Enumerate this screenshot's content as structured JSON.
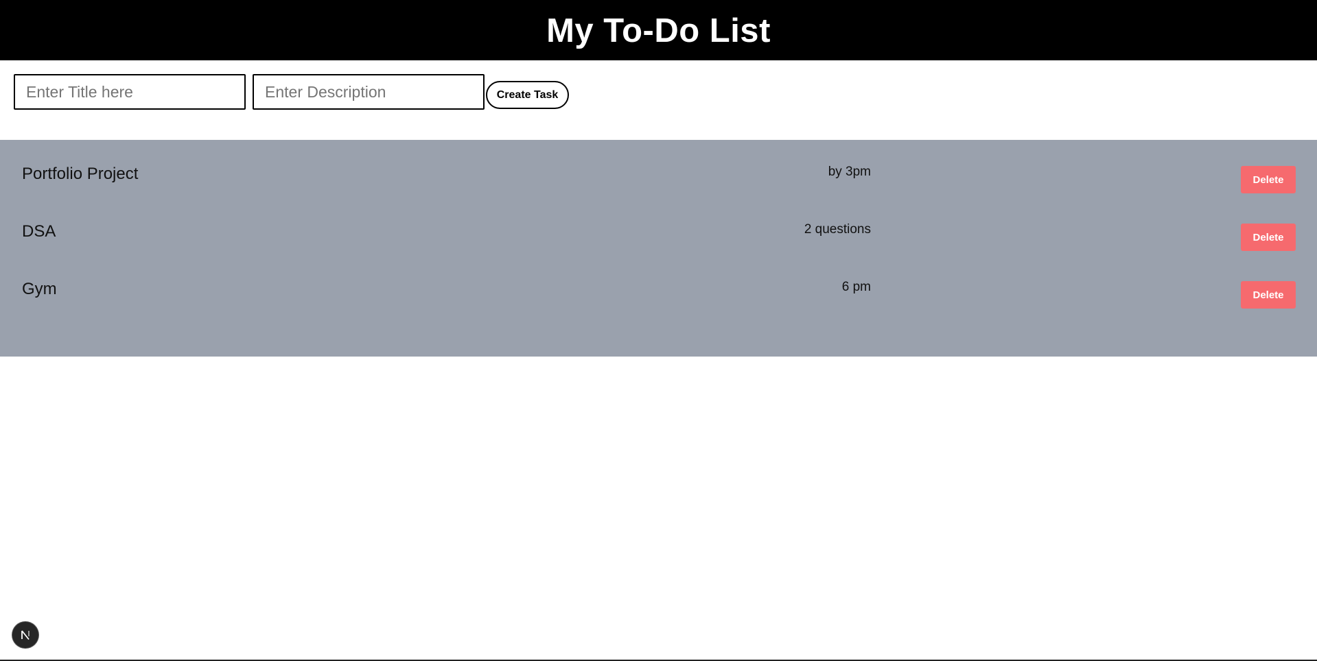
{
  "header": {
    "title": "My To-Do List"
  },
  "form": {
    "title_placeholder": "Enter Title here",
    "title_value": "",
    "description_placeholder": "Enter Description",
    "description_value": "",
    "create_label": "Create Task"
  },
  "tasks": [
    {
      "title": "Portfolio Project",
      "description": "by 3pm",
      "delete_label": "Delete"
    },
    {
      "title": "DSA",
      "description": "2 questions",
      "delete_label": "Delete"
    },
    {
      "title": "Gym",
      "description": "6 pm",
      "delete_label": "Delete"
    }
  ],
  "dev_badge": {
    "letter": "N",
    "icon": "nextjs-logo-icon"
  },
  "colors": {
    "header_bg": "#000000",
    "panel_bg": "#9aa1ad",
    "delete_bg": "#f66a6e"
  }
}
